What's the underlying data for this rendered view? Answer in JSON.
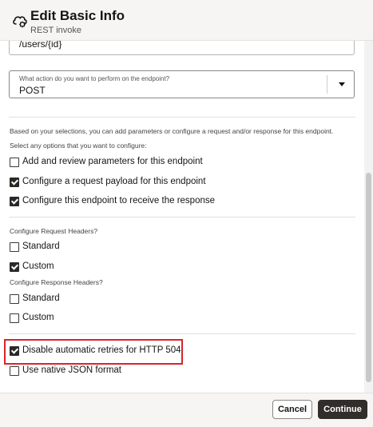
{
  "header": {
    "title": "Edit Basic Info",
    "subtitle": "REST invoke",
    "icon": "cloud-gear-icon"
  },
  "top_field": {
    "value": "/users/{id}"
  },
  "action_select": {
    "label": "What action do you want to perform on the endpoint?",
    "value": "POST"
  },
  "intro": {
    "line1": "Based on your selections, you can add parameters or configure a request and/or response for this endpoint.",
    "line2": "Select any options that you want to configure:"
  },
  "options": [
    {
      "label": "Add and review parameters for this endpoint",
      "checked": false
    },
    {
      "label": "Configure a request payload for this endpoint",
      "checked": true
    },
    {
      "label": "Configure this endpoint to receive the response",
      "checked": true
    }
  ],
  "request_headers": {
    "label": "Configure Request Headers?",
    "standard": {
      "label": "Standard",
      "checked": false
    },
    "custom": {
      "label": "Custom",
      "checked": true
    }
  },
  "response_headers": {
    "label": "Configure Response Headers?",
    "standard": {
      "label": "Standard",
      "checked": false
    },
    "custom": {
      "label": "Custom",
      "checked": false
    }
  },
  "extra": [
    {
      "label": "Disable automatic retries for HTTP 504",
      "checked": true
    },
    {
      "label": "Use native JSON format",
      "checked": false
    }
  ],
  "footer": {
    "cancel_label": "Cancel",
    "continue_label": "Continue"
  },
  "colors": {
    "highlight": "#d9252b",
    "primary_button": "#312d2a"
  }
}
